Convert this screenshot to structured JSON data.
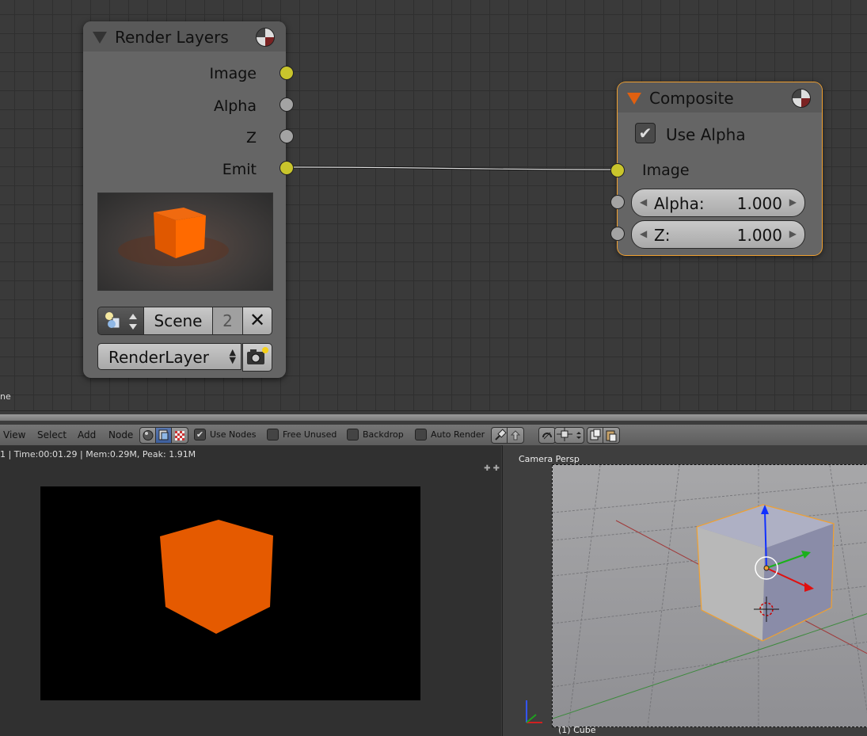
{
  "node_editor": {
    "render_layers_node": {
      "title": "Render Layers",
      "outputs": [
        "Image",
        "Alpha",
        "Z",
        "Emit"
      ],
      "scene": {
        "name": "Scene",
        "users": "2"
      },
      "layer": "RenderLayer"
    },
    "composite_node": {
      "title": "Composite",
      "use_alpha_label": "Use Alpha",
      "use_alpha_checked": true,
      "image_input": "Image",
      "alpha_field": {
        "label": "Alpha:",
        "value": "1.000"
      },
      "z_field": {
        "label": "Z:",
        "value": "1.000"
      }
    },
    "left_edge_text": "ne",
    "colors": {
      "socket_yellow": "#c9c52c",
      "socket_gray": "#a3a3a3",
      "selected_outline": "#f0a030"
    }
  },
  "header": {
    "menus": [
      "View",
      "Select",
      "Add",
      "Node"
    ],
    "use_nodes_label": "Use Nodes",
    "use_nodes_checked": true,
    "free_unused_label": "Free Unused",
    "backdrop_label": "Backdrop",
    "auto_render_label": "Auto Render"
  },
  "image_editor": {
    "info_text": "1 | Time:00:01.29 | Mem:0.29M, Peak: 1.91M",
    "cube_color": "#e55a00"
  },
  "viewport": {
    "view_label": "Camera Persp",
    "object_label": "(1) Cube"
  }
}
